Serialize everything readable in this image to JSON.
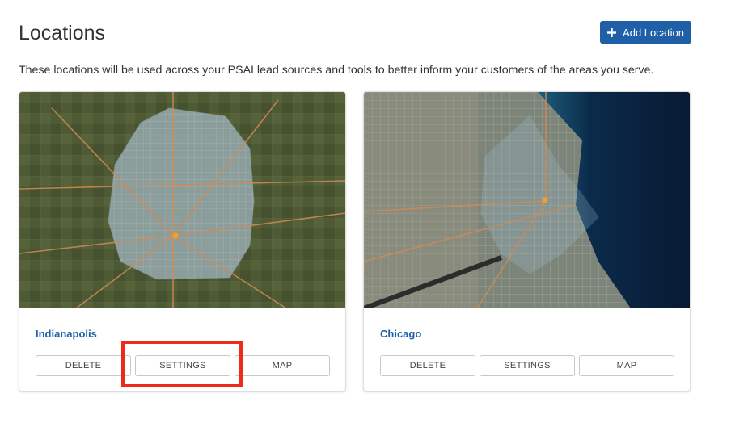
{
  "header": {
    "title": "Locations",
    "add_button_label": "Add Location"
  },
  "intro_text": "These locations will be used across your PSAI lead sources and tools to better inform your customers of the areas you serve.",
  "locations": [
    {
      "name": "Indianapolis",
      "buttons": {
        "delete": "DELETE",
        "settings": "SETTINGS",
        "map": "MAP"
      }
    },
    {
      "name": "Chicago",
      "buttons": {
        "delete": "DELETE",
        "settings": "SETTINGS",
        "map": "MAP"
      }
    }
  ],
  "colors": {
    "accent": "#1f5fa8",
    "highlight": "#ee2a1a",
    "lake": "#0b2a4a"
  },
  "icons": {
    "add": "plus-icon",
    "pin": "map-pin-icon"
  }
}
